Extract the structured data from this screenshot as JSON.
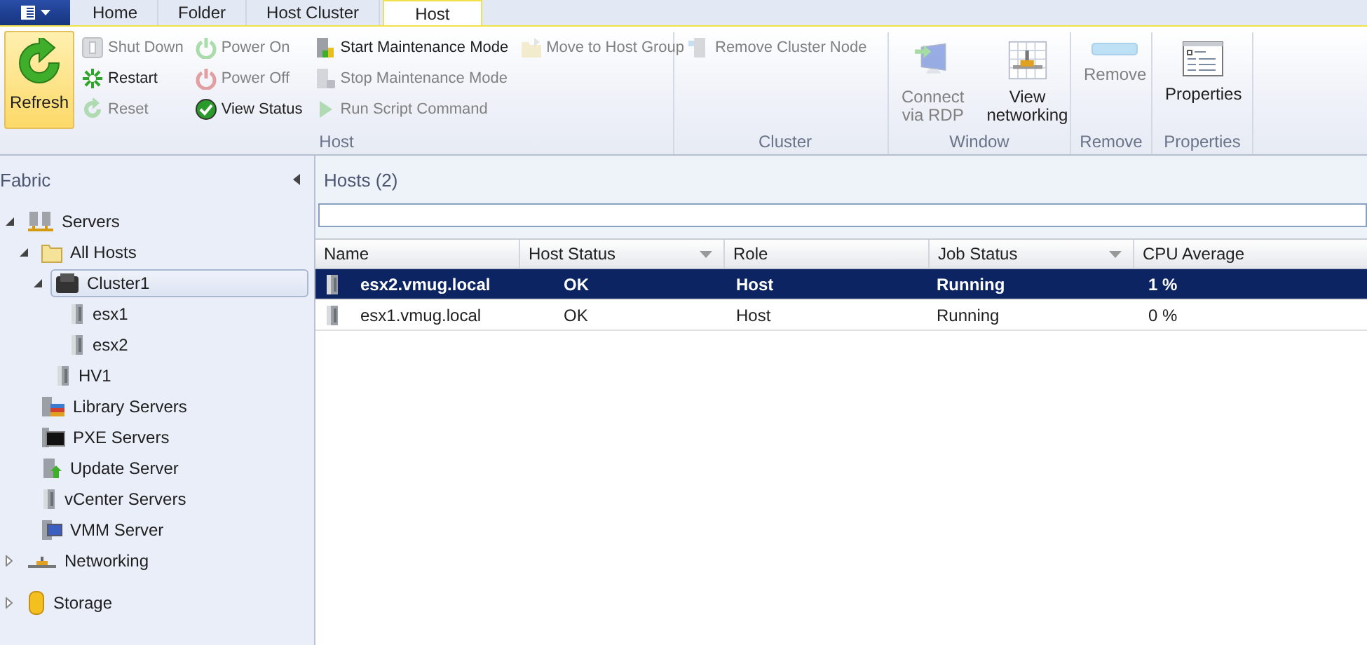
{
  "tabs": [
    {
      "label": "Home",
      "selected": false
    },
    {
      "label": "Folder",
      "selected": false
    },
    {
      "label": "Host Cluster",
      "selected": false
    },
    {
      "label": "Host",
      "selected": true
    }
  ],
  "ribbon": {
    "groups": [
      {
        "label": "Host",
        "columns": [
          [
            {
              "label": "Refresh",
              "kind": "large",
              "disabled": false,
              "highlighted": true
            }
          ],
          [
            {
              "label": "Shut Down",
              "kind": "small",
              "disabled": true,
              "highlighted": false
            },
            {
              "label": "Restart",
              "kind": "small",
              "disabled": false,
              "highlighted": false
            },
            {
              "label": "Reset",
              "kind": "small",
              "disabled": true,
              "highlighted": false
            }
          ],
          [
            {
              "label": "Power On",
              "kind": "small",
              "disabled": true,
              "highlighted": false
            },
            {
              "label": "Power Off",
              "kind": "small",
              "disabled": true,
              "highlighted": false
            },
            {
              "label": "View Status",
              "kind": "small",
              "disabled": false,
              "highlighted": false
            }
          ],
          [
            {
              "label": "Start Maintenance Mode",
              "kind": "small",
              "disabled": false,
              "highlighted": false
            },
            {
              "label": "Stop Maintenance Mode",
              "kind": "small",
              "disabled": true,
              "highlighted": false
            },
            {
              "label": "Run Script Command",
              "kind": "small",
              "disabled": true,
              "highlighted": false
            }
          ],
          [
            {
              "label": "Move to Host Group",
              "kind": "small",
              "disabled": true,
              "highlighted": false
            }
          ]
        ]
      },
      {
        "label": "Cluster",
        "columns": [
          [
            {
              "label": "Remove Cluster Node",
              "kind": "small",
              "disabled": true,
              "highlighted": false
            }
          ]
        ]
      },
      {
        "label": "Window",
        "columns": [
          [
            {
              "label": "Connect\nvia RDP",
              "kind": "large",
              "disabled": true,
              "highlighted": false
            }
          ],
          [
            {
              "label": "View\nnetworking",
              "kind": "large",
              "disabled": false,
              "highlighted": false
            }
          ]
        ]
      },
      {
        "label": "Remove",
        "columns": [
          [
            {
              "label": "Remove",
              "kind": "large",
              "disabled": true,
              "highlighted": false
            }
          ]
        ]
      },
      {
        "label": "Properties",
        "columns": [
          [
            {
              "label": "Properties",
              "kind": "large",
              "disabled": false,
              "highlighted": false
            }
          ]
        ]
      }
    ]
  },
  "navigation": {
    "title": "Fabric",
    "tree": [
      {
        "label": "Servers",
        "expanded": true,
        "selected": false,
        "children": [
          {
            "label": "All Hosts",
            "expanded": true,
            "selected": false,
            "children": [
              {
                "label": "Cluster1",
                "expanded": true,
                "selected": true,
                "children": [
                  {
                    "label": "esx1",
                    "selected": false
                  },
                  {
                    "label": "esx2",
                    "selected": false
                  }
                ]
              },
              {
                "label": "HV1",
                "selected": false
              }
            ]
          },
          {
            "label": "Library Servers",
            "selected": false
          },
          {
            "label": "PXE Servers",
            "selected": false
          },
          {
            "label": "Update Server",
            "selected": false
          },
          {
            "label": "vCenter Servers",
            "selected": false
          },
          {
            "label": "VMM Server",
            "selected": false
          }
        ]
      },
      {
        "label": "Networking",
        "expanded": false,
        "selected": false
      },
      {
        "label": "Storage",
        "expanded": false,
        "selected": false
      }
    ]
  },
  "hosts": {
    "title": "Hosts (2)",
    "columns": [
      {
        "label": "Name",
        "filter": false
      },
      {
        "label": "Host Status",
        "filter": true
      },
      {
        "label": "Role",
        "filter": false
      },
      {
        "label": "Job Status",
        "filter": true
      },
      {
        "label": "CPU Average",
        "filter": false
      }
    ],
    "rows": [
      {
        "selected": true,
        "cells": [
          "esx2.vmug.local",
          "OK",
          "Host",
          "Running",
          "1 %"
        ]
      },
      {
        "selected": false,
        "cells": [
          "esx1.vmug.local",
          "OK",
          "Host",
          "Running",
          "0 %"
        ]
      }
    ]
  }
}
